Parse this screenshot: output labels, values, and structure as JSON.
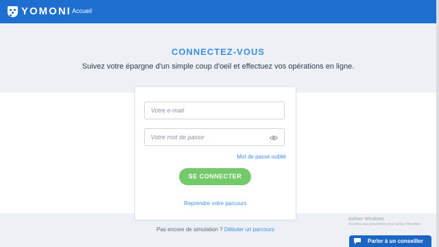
{
  "header": {
    "brand": "YOMONI",
    "nav_home": "Accueil"
  },
  "hero": {
    "title": "CONNECTEZ-VOUS",
    "subtitle": "Suivez votre épargne d'un simple coup d'oeil et effectuez vos opérations en ligne."
  },
  "login": {
    "email_placeholder": "Votre e-mail",
    "password_placeholder": "Votre mot de passe",
    "forgot_password": "Mot de passe oublié",
    "submit_label": "SE CONNECTER",
    "resume_link": "Reprendre votre parcours"
  },
  "footer": {
    "no_simulation_text": "Pas encore de simulation ?",
    "start_link": "Débuter un parcours"
  },
  "windows_watermark": {
    "title": "Activer Windows",
    "subtitle": "Accédez aux paramètres pour activer Windows."
  },
  "advisor_button": {
    "label": "Parler à un conseiller"
  },
  "icons": {
    "logo": "shield-dots-logo",
    "eye": "eye-icon",
    "chat": "chat-bubble-icon"
  },
  "colors": {
    "header_bg": "#1f6fd0",
    "accent_blue": "#3b8fe3",
    "button_green": "#74c96a",
    "band_gray": "#edf0f4"
  }
}
